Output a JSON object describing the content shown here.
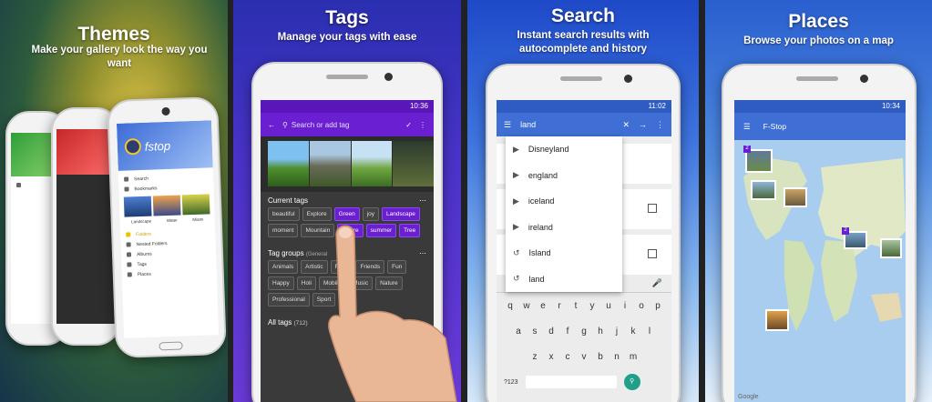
{
  "panels": {
    "themes": {
      "title": "Themes",
      "subtitle": "Make your gallery look the way you want",
      "app_logo_text": "fstop",
      "drawer_items": [
        "Search",
        "Bookmarks",
        "Folders",
        "Nested Folders",
        "Albums",
        "Tags",
        "Places"
      ],
      "thumb_labels": [
        "Landscape",
        "Water",
        "Miami"
      ]
    },
    "tags": {
      "title": "Tags",
      "subtitle": "Manage your tags with ease",
      "time": "10:36",
      "search_placeholder": "Search or add tag",
      "current_tags_title": "Current tags",
      "current_tags": [
        {
          "label": "beautiful",
          "selected": false
        },
        {
          "label": "Explore",
          "selected": false
        },
        {
          "label": "Green",
          "selected": true
        },
        {
          "label": "joy",
          "selected": false
        },
        {
          "label": "Landscape",
          "selected": true
        },
        {
          "label": "moment",
          "selected": false
        },
        {
          "label": "Mountain",
          "selected": false
        },
        {
          "label": "nature",
          "selected": true
        },
        {
          "label": "summer",
          "selected": true
        },
        {
          "label": "Tree",
          "selected": true
        }
      ],
      "tag_groups_title": "Tag groups",
      "tag_groups_hint": "(General",
      "tag_groups": [
        "Animals",
        "Artistic",
        "Food",
        "Friends",
        "Fun",
        "Happy",
        "Holi",
        "Mobile",
        "Music",
        "Nature",
        "Professional",
        "Sport"
      ],
      "all_tags_title": "All tags",
      "all_tags_count": "(712)",
      "accent": "#6a1fd0"
    },
    "search": {
      "title": "Search",
      "subtitle": "Instant search results with autocomplete and history",
      "time": "11:02",
      "query": "land",
      "suggestions": [
        {
          "label": "Disneyland",
          "icon": "tag-icon"
        },
        {
          "label": "england",
          "icon": "tag-icon"
        },
        {
          "label": "iceland",
          "icon": "tag-icon"
        },
        {
          "label": "ireland",
          "icon": "tag-icon"
        },
        {
          "label": "Island",
          "icon": "history-icon"
        },
        {
          "label": "land",
          "icon": "history-icon"
        }
      ],
      "keyboard_rows": [
        [
          "q",
          "w",
          "e",
          "r",
          "t",
          "y",
          "u",
          "i",
          "o",
          "p"
        ],
        [
          "a",
          "s",
          "d",
          "f",
          "g",
          "h",
          "j",
          "k",
          "l"
        ],
        [
          "z",
          "x",
          "c",
          "v",
          "b",
          "n",
          "m"
        ]
      ],
      "keyboard_numkey": "?123"
    },
    "places": {
      "title": "Places",
      "subtitle": "Browse your photos on a map",
      "time": "10:34",
      "app_title": "F-Stop",
      "map_attribution": "Google",
      "badges": [
        "2",
        "2",
        "2"
      ]
    }
  }
}
